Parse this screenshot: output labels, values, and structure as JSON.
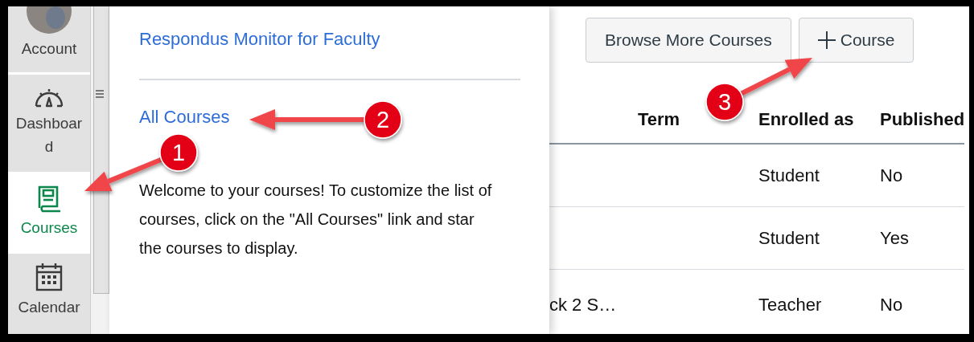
{
  "sidebar": {
    "items": [
      {
        "label": "Account",
        "kind": "avatar",
        "selected": false
      },
      {
        "label": "Dashboard",
        "kind": "dashboard",
        "selected": false
      },
      {
        "label": "Courses",
        "kind": "courses",
        "selected": true
      },
      {
        "label": "Calendar",
        "kind": "calendar",
        "selected": false
      }
    ]
  },
  "flyout": {
    "links": [
      "Respondus Monitor for Faculty"
    ],
    "all_courses_link": "All Courses",
    "welcome": "Welcome to your courses! To customize the list of courses, click on the \"All Courses\" link and star the courses to display."
  },
  "toolbar": {
    "buttons": [
      {
        "label": "Browse More Courses",
        "kind": "plain"
      },
      {
        "label": "Course",
        "kind": "add"
      }
    ]
  },
  "table": {
    "columns": [
      "Term",
      "Enrolled as",
      "Published"
    ],
    "rows": [
      {
        "enrolled_as": "Student",
        "published": "No"
      },
      {
        "enrolled_as": "Student",
        "published": "Yes"
      },
      {
        "column_1": "ck 2 S…",
        "enrolled_as": "Teacher",
        "published": "No"
      }
    ]
  },
  "annotations": [
    {
      "label": "1"
    },
    {
      "label": "2"
    },
    {
      "label": "3"
    }
  ]
}
